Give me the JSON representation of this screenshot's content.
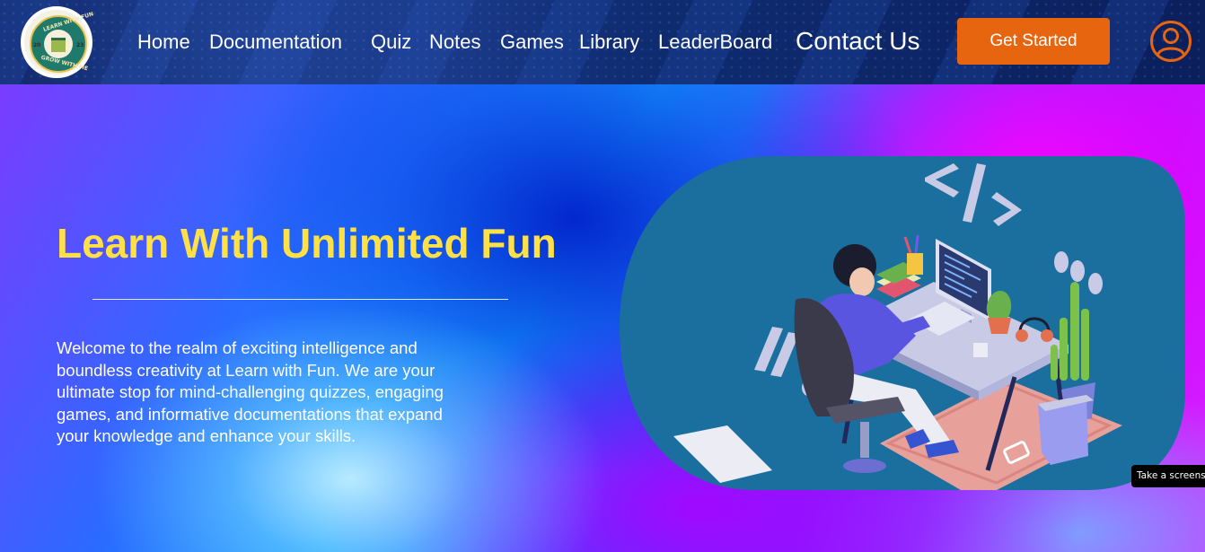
{
  "logo": {
    "top_text": "LEARN WITH FUN",
    "bottom_text": "GROW WITH ME",
    "year_left": "20",
    "year_right": "23"
  },
  "nav": {
    "links": [
      {
        "label": "Home"
      },
      {
        "label": "Documentation"
      },
      {
        "label": "Quiz"
      },
      {
        "label": "Notes"
      },
      {
        "label": "Games"
      },
      {
        "label": "Library"
      },
      {
        "label": "LeaderBoard"
      },
      {
        "label": "Contact Us"
      }
    ],
    "cta_label": "Get Started",
    "profile_icon": "user-circle-icon"
  },
  "hero": {
    "title": "Learn With Unlimited Fun",
    "description": "Welcome to the realm of exciting intelligence and boundless creativity at Learn with Fun. We are your ultimate stop for mind-challenging quizzes, engaging games, and informative documentations that expand your knowledge and enhance your skills.",
    "illustration": "developer-at-desk-illustration"
  },
  "tooltip": {
    "text": "Take a screens"
  },
  "colors": {
    "nav_bg": "#0e2a6e",
    "cta": "#e8650f",
    "profile": "#e8650f",
    "title": "#ffe045",
    "illustration_bg": "#1a6f9e"
  }
}
